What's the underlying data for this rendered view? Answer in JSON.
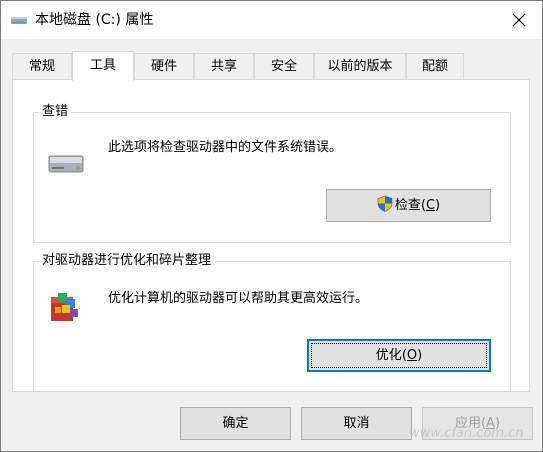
{
  "window": {
    "title": "本地磁盘 (C:) 属性",
    "icons": {
      "title": "drive-icon",
      "close": "close-icon"
    }
  },
  "tabs": [
    {
      "label": "常规",
      "active": false
    },
    {
      "label": "工具",
      "active": true
    },
    {
      "label": "硬件",
      "active": false
    },
    {
      "label": "共享",
      "active": false
    },
    {
      "label": "安全",
      "active": false
    },
    {
      "label": "以前的版本",
      "active": false
    },
    {
      "label": "配额",
      "active": false
    }
  ],
  "error_check": {
    "title": "查错",
    "description": "此选项将检查驱动器中的文件系统错误。",
    "button_label": "检查",
    "button_accel": "C",
    "icon": "hard-drive-icon",
    "button_icon": "uac-shield-icon"
  },
  "optimize": {
    "title": "对驱动器进行优化和碎片整理",
    "description": "优化计算机的驱动器可以帮助其更高效运行。",
    "button_label": "优化",
    "button_accel": "O",
    "icon": "defrag-icon"
  },
  "footer": {
    "ok_label": "确定",
    "cancel_label": "取消",
    "apply_label": "应用",
    "apply_accel": "A",
    "apply_enabled": false
  },
  "watermark": "www.cfan.com.cn",
  "colors": {
    "focus_border": "#0078d7",
    "button_face": "#e1e1e1",
    "button_border": "#adadad",
    "disabled_text": "#a0a0a0"
  }
}
